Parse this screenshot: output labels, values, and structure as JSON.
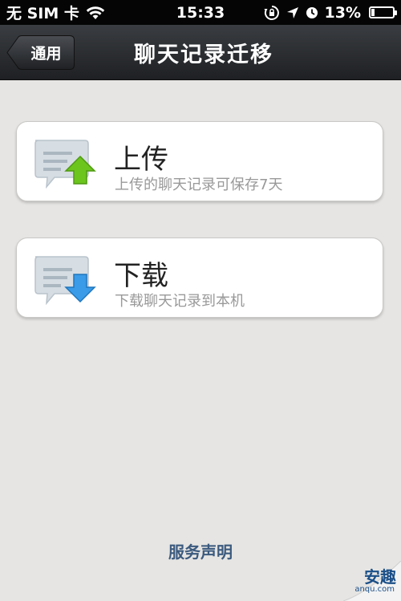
{
  "status_bar": {
    "carrier": "无 SIM 卡",
    "time": "15:33",
    "battery": "13%",
    "battery_level": 0.13
  },
  "nav": {
    "back_label": "通用",
    "title": "聊天记录迁移"
  },
  "upload": {
    "title": "上传",
    "subtitle": "上传的聊天记录可保存7天",
    "arrow_color": "#6cc51c"
  },
  "download": {
    "title": "下载",
    "subtitle": "下载聊天记录到本机",
    "arrow_color": "#3a9be8"
  },
  "footer": {
    "service_link": "服务声明"
  },
  "watermark": {
    "brand": "安趣",
    "url": "anqu.com"
  }
}
